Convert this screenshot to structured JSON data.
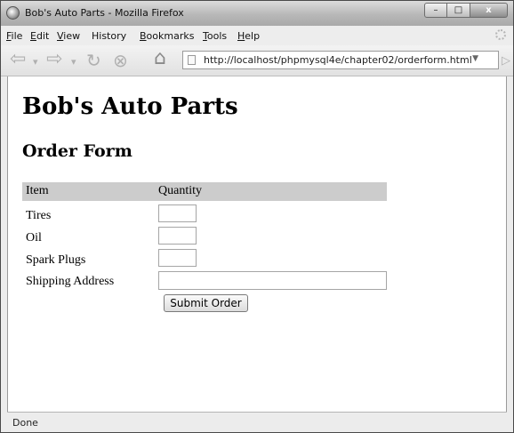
{
  "window": {
    "title": "Bob's Auto Parts - Mozilla Firefox"
  },
  "window_controls": {
    "minimize": "–",
    "maximize": "□",
    "close": "x"
  },
  "menu": [
    {
      "label": "File",
      "accel": "F",
      "rest": "ile"
    },
    {
      "label": "Edit",
      "accel": "E",
      "rest": "dit"
    },
    {
      "label": "View",
      "accel": "V",
      "rest": "iew"
    },
    {
      "label": "History",
      "accel": "",
      "rest": "History"
    },
    {
      "label": "Bookmarks",
      "accel": "B",
      "rest": "ookmarks"
    },
    {
      "label": "Tools",
      "accel": "T",
      "rest": "ools"
    },
    {
      "label": "Help",
      "accel": "H",
      "rest": "elp"
    }
  ],
  "toolbar": {
    "back": "⇦",
    "back_drop": "▾",
    "forward": "⇨",
    "forward_drop": "▾",
    "reload": "↻",
    "stop": "⊗",
    "home": "⌂",
    "url": "http://localhost/phpmysql4e/chapter02/orderform.html",
    "url_drop": "▼",
    "go": "▷"
  },
  "page": {
    "heading": "Bob's Auto Parts",
    "subheading": "Order Form",
    "table": {
      "headers": [
        "Item",
        "Quantity"
      ],
      "rows": [
        {
          "label": "Tires",
          "value": ""
        },
        {
          "label": "Oil",
          "value": ""
        },
        {
          "label": "Spark Plugs",
          "value": ""
        }
      ],
      "address_label": "Shipping Address",
      "address_value": ""
    },
    "submit_label": "Submit Order"
  },
  "status": {
    "text": "Done"
  }
}
